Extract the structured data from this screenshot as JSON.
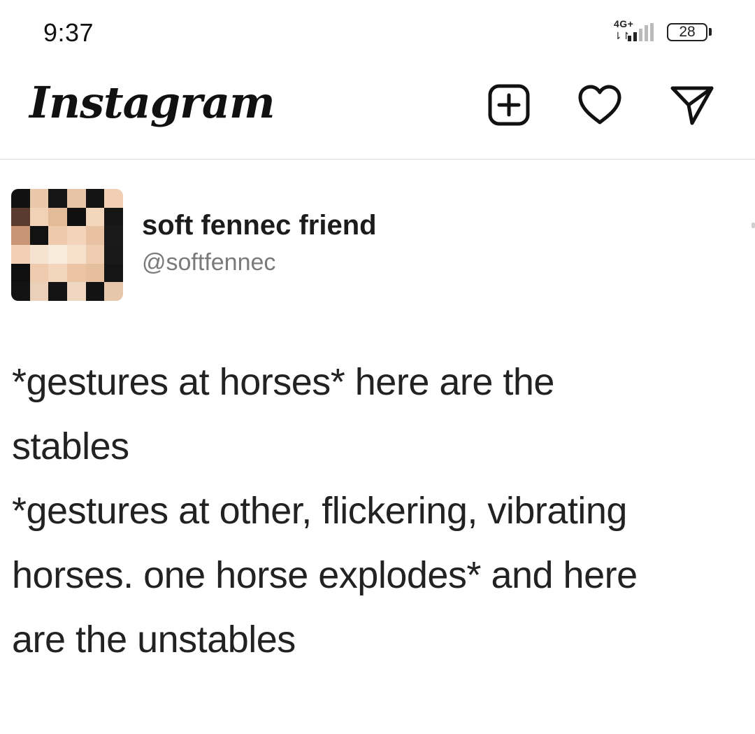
{
  "status_bar": {
    "time": "9:37",
    "network": "4G+",
    "network_arrows": "⇂↾",
    "battery": "28"
  },
  "header": {
    "logo": "Instagram",
    "icons": [
      "new-post-icon",
      "heart-icon",
      "direct-message-icon"
    ]
  },
  "post": {
    "author_name": "soft fennec friend",
    "author_handle": "@softfennec",
    "text_lines": [
      "*gestures at horses* here are the",
      "stables",
      "*gestures at other, flickering, vibrating",
      "horses. one horse explodes* and here",
      "are the unstables"
    ]
  },
  "colors": {
    "text": "#111111",
    "handle": "#7a7a7a",
    "divider": "#dcdcdc"
  }
}
